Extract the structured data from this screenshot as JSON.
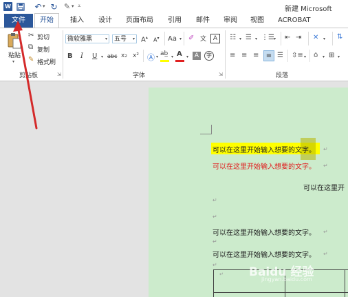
{
  "title_bar": {
    "word_icon_glyph": "W",
    "title": "新建 Microsoft"
  },
  "tabs": [
    {
      "label": "文件"
    },
    {
      "label": "开始"
    },
    {
      "label": "插入"
    },
    {
      "label": "设计"
    },
    {
      "label": "页面布局"
    },
    {
      "label": "引用"
    },
    {
      "label": "邮件"
    },
    {
      "label": "审阅"
    },
    {
      "label": "视图"
    },
    {
      "label": "ACROBAT"
    }
  ],
  "clipboard": {
    "paste": "粘贴",
    "cut": "剪切",
    "copy": "复制",
    "format_painter": "格式刷",
    "group_label": "剪贴板"
  },
  "font": {
    "font_name": "微软雅黑",
    "font_size": "五号",
    "group_label": "字体",
    "grow": "A",
    "shrink": "A",
    "case": "Aa",
    "bold": "B",
    "italic": "I",
    "underline": "U",
    "strikethrough": "abc",
    "subscript": "x₂",
    "superscript": "x²",
    "font_color_glyph": "A",
    "char_shade_glyph": "A",
    "phonetic_glyph": "文",
    "border_glyph": "A",
    "enclose_glyph": "字"
  },
  "paragraph": {
    "group_label": "段落"
  },
  "document": {
    "lines": [
      "可以在这里开始输入想要的文字。",
      "可以在这里开始输入想要的文字。",
      "可以在这里开",
      "可以在这里开始输入想要的文字。",
      "可以在这里开始输入想要的文字。"
    ],
    "para_mark": "↵",
    "text_colors": {
      "normal": "#222222",
      "red": "#e02020",
      "highlight": "#ffff00"
    }
  },
  "watermark": {
    "text": "Baidu 经验",
    "url": "jingyan.baidu.com"
  },
  "annotation": {
    "arrow_color": "#d42a2a"
  }
}
